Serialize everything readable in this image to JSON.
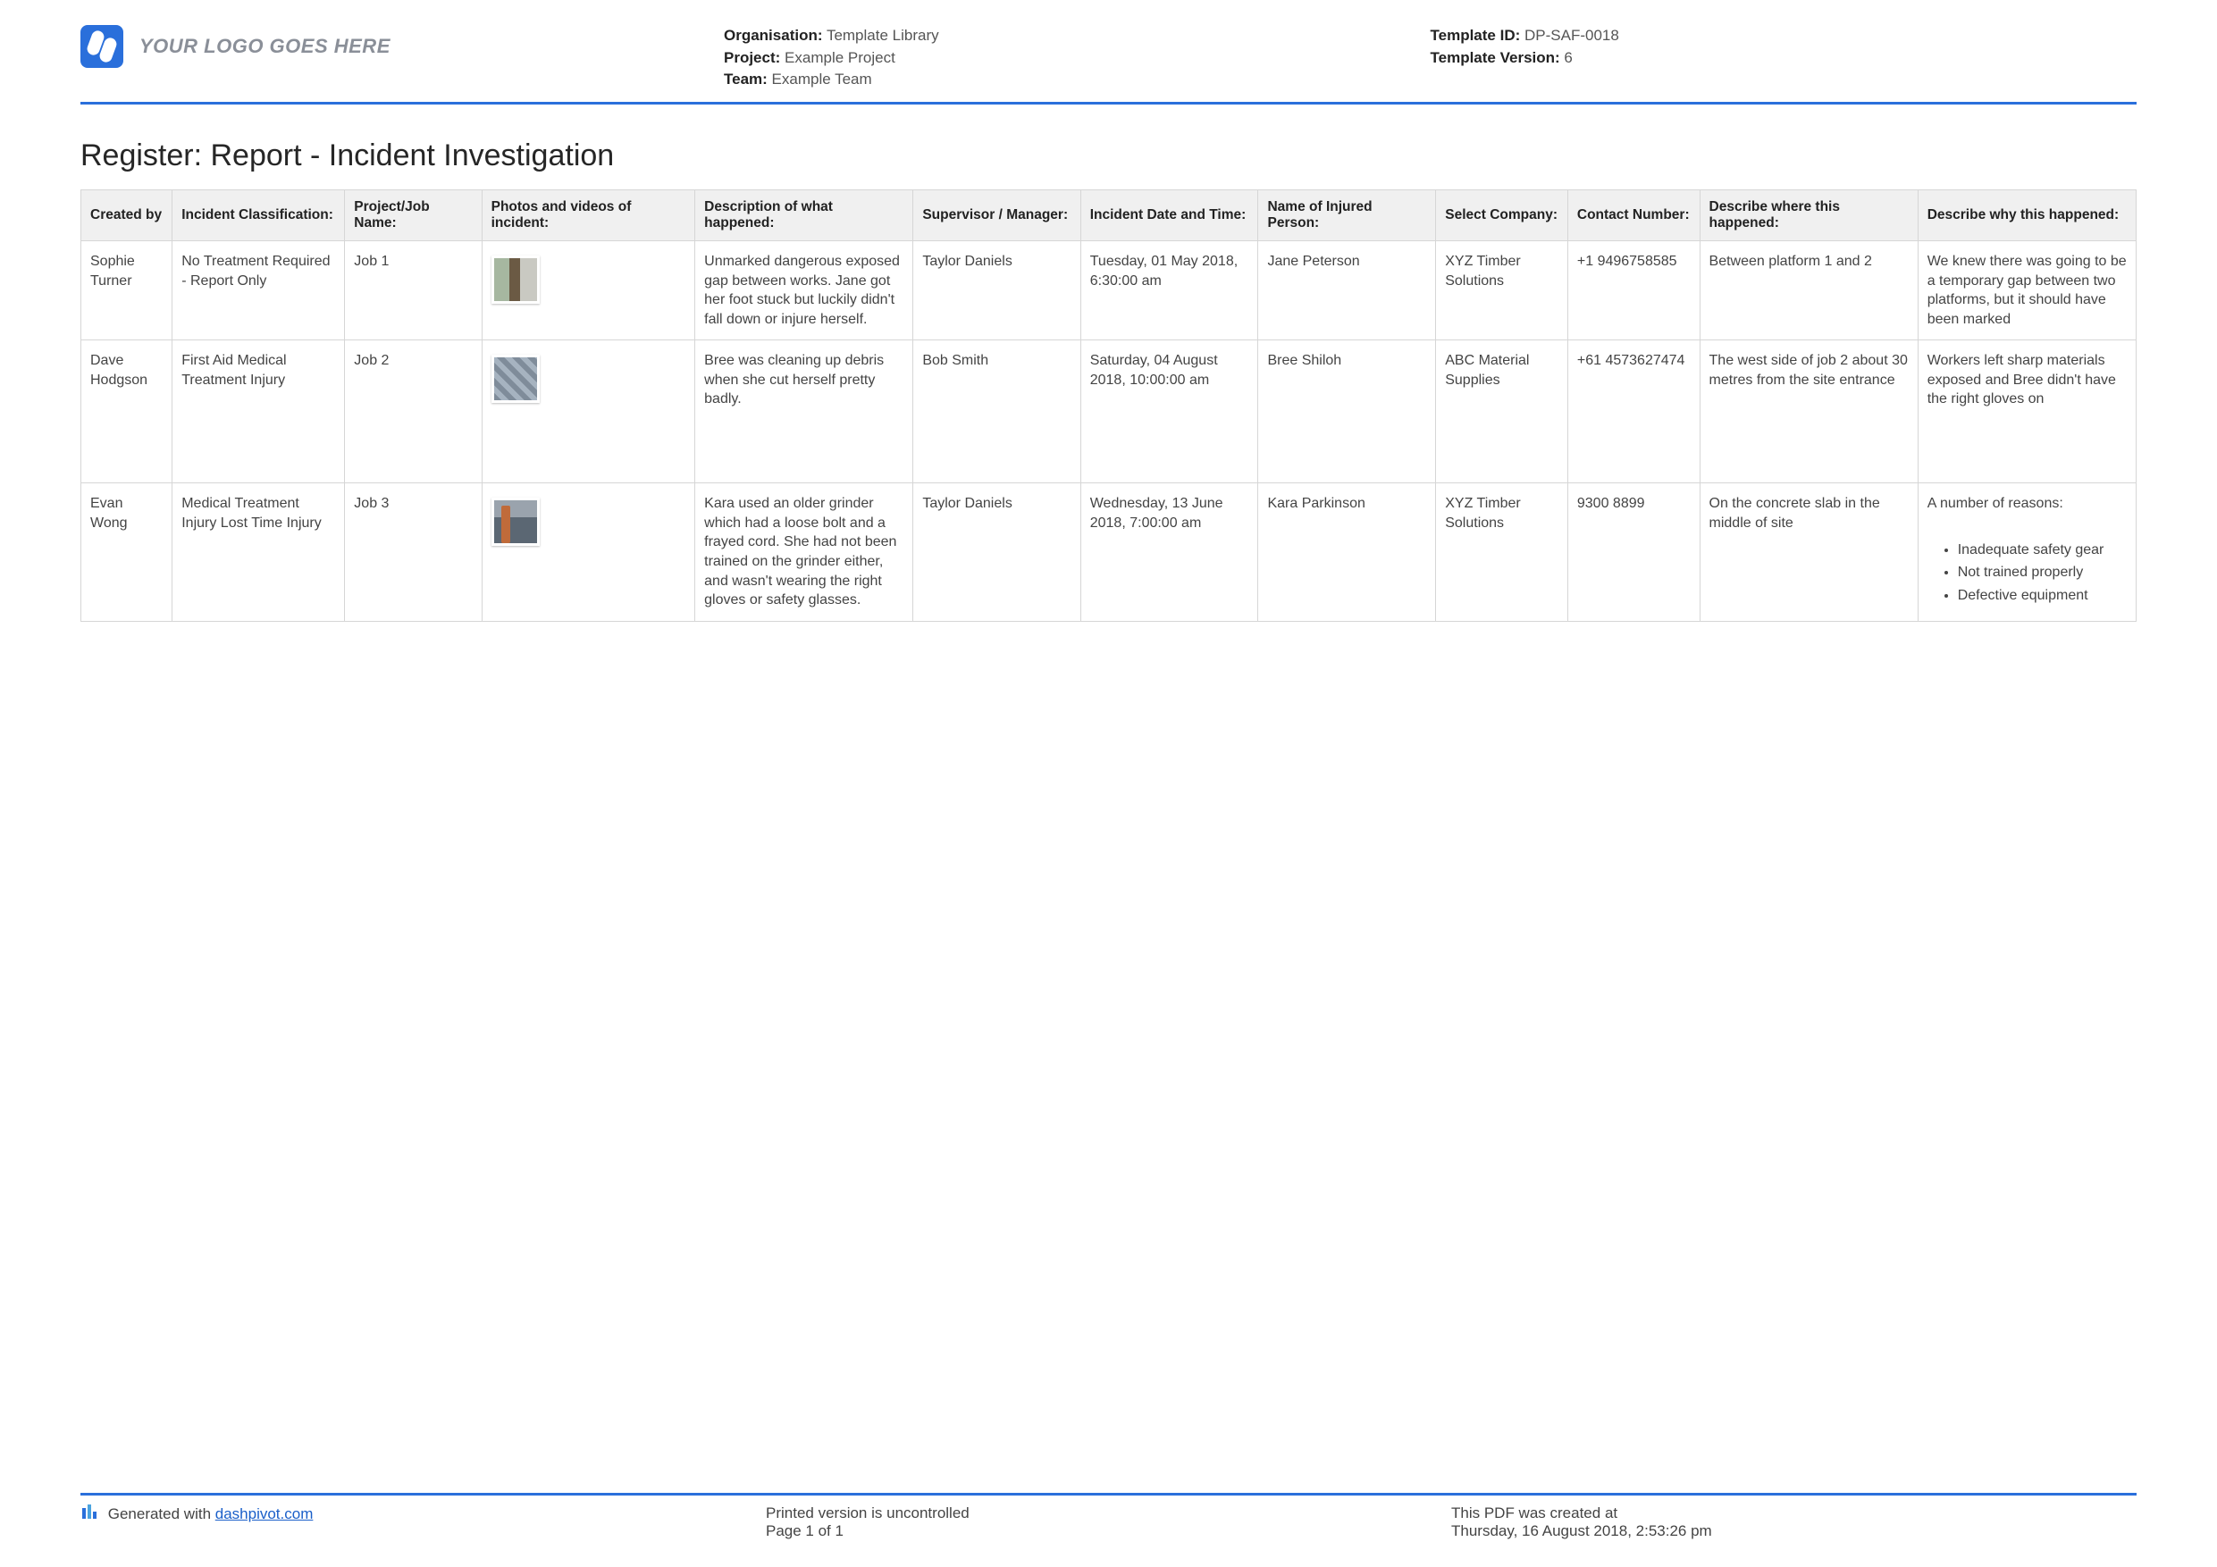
{
  "header": {
    "logo_placeholder": "YOUR LOGO GOES HERE",
    "meta_left": {
      "organisation_label": "Organisation:",
      "organisation_value": "Template Library",
      "project_label": "Project:",
      "project_value": "Example Project",
      "team_label": "Team:",
      "team_value": "Example Team"
    },
    "meta_right": {
      "template_id_label": "Template ID:",
      "template_id_value": "DP-SAF-0018",
      "template_version_label": "Template Version:",
      "template_version_value": "6"
    }
  },
  "title": "Register: Report - Incident Investigation",
  "columns": [
    "Created by",
    "Incident Classification:",
    "Project/Job Name:",
    "Photos and videos of incident:",
    "Description of what happened:",
    "Supervisor / Manager:",
    "Incident Date and Time:",
    "Name of Injured Person:",
    "Select Company:",
    "Contact Number:",
    "Describe where this happened:",
    "Describe why this happened:"
  ],
  "rows": [
    {
      "created_by": "Sophie Turner",
      "classification": "No Treatment Required - Report Only",
      "job": "Job 1",
      "thumb_class": "t1",
      "description": "Unmarked dangerous exposed gap between works. Jane got her foot stuck but luckily didn't fall down or injure herself.",
      "supervisor": "Taylor Daniels",
      "datetime": "Tuesday, 01 May 2018, 6:30:00 am",
      "injured": "Jane Peterson",
      "company": "XYZ Timber Solutions",
      "contact": "+1 9496758585",
      "where": "Between platform 1 and 2",
      "why_text": "We knew there was going to be a temporary gap between two platforms, but it should have been marked",
      "why_list": []
    },
    {
      "created_by": "Dave Hodgson",
      "classification": "First Aid   Medical Treatment Injury",
      "job": "Job 2",
      "thumb_class": "t2",
      "description": "Bree was cleaning up debris when she cut herself pretty badly.",
      "supervisor": "Bob Smith",
      "datetime": "Saturday, 04 August 2018, 10:00:00 am",
      "injured": "Bree Shiloh",
      "company": "ABC Material Supplies",
      "contact": "+61 4573627474",
      "where": "The west side of job 2 about 30 metres from the site entrance",
      "why_text": "Workers left sharp materials exposed and Bree didn't have the right gloves on",
      "why_list": []
    },
    {
      "created_by": "Evan Wong",
      "classification": "Medical Treatment Injury   Lost Time Injury",
      "job": "Job 3",
      "thumb_class": "t3",
      "description": "Kara used an older grinder which had a loose bolt and a frayed cord. She had not been trained on the grinder either, and wasn't wearing the right gloves or safety glasses.",
      "supervisor": "Taylor Daniels",
      "datetime": "Wednesday, 13 June 2018, 7:00:00 am",
      "injured": "Kara Parkinson",
      "company": "XYZ Timber Solutions",
      "contact": "9300 8899",
      "where": "On the concrete slab in the middle of site",
      "why_text": "A number of reasons:",
      "why_list": [
        "Inadequate safety gear",
        "Not trained properly",
        "Defective equipment"
      ]
    }
  ],
  "footer": {
    "generated_prefix": "Generated with ",
    "generated_link": "dashpivot.com",
    "uncontrolled": "Printed version is uncontrolled",
    "page": "Page 1 of 1",
    "created_label": "This PDF was created at",
    "created_value": "Thursday, 16 August 2018, 2:53:26 pm"
  }
}
